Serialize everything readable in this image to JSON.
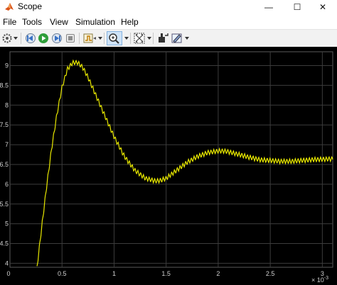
{
  "window": {
    "title": "Scope",
    "minimize_icon": "minimize-icon",
    "maximize_icon": "maximize-icon",
    "close_icon": "close-icon"
  },
  "menu": {
    "items": [
      "File",
      "Tools",
      "View",
      "Simulation",
      "Help"
    ]
  },
  "toolbar": {
    "icons": [
      "settings-gear-icon",
      "step-back-icon",
      "run-icon",
      "stop-icon",
      "trigger-icon",
      "zoom-icon",
      "autoscale-icon",
      "cursor-measure-icon",
      "style-icon"
    ]
  },
  "colors": {
    "background": "#000000",
    "grid": "#3c3c3c",
    "trace": "#e8e800",
    "tick_text": "#d0d0d0"
  },
  "chart_data": {
    "type": "line",
    "title": "",
    "xlabel": "",
    "ylabel": "",
    "x_multiplier_label": "× 10",
    "x_multiplier_exponent": "-3",
    "xlim": [
      0,
      3.1
    ],
    "ylim": [
      3.9,
      9.35
    ],
    "x_ticks": [
      "0",
      "0.5",
      "1",
      "1.5",
      "2",
      "2.5",
      "3"
    ],
    "y_ticks": [
      "4",
      "4.5",
      "5",
      "5.5",
      "6",
      "6.5",
      "7",
      "7.5",
      "8",
      "8.5",
      "9"
    ],
    "grid": true,
    "ripple_amplitude": 0.06,
    "ripple_period": 0.027,
    "series": [
      {
        "x": [
          0.26,
          0.3,
          0.35,
          0.4,
          0.45,
          0.5,
          0.55,
          0.6,
          0.65,
          0.7,
          0.75,
          0.8,
          0.9,
          1.0,
          1.1,
          1.2,
          1.3,
          1.4,
          1.45,
          1.5,
          1.6,
          1.7,
          1.8,
          1.9,
          2.0,
          2.05,
          2.1,
          2.2,
          2.3,
          2.4,
          2.5,
          2.6,
          2.7,
          2.8,
          2.9,
          3.0,
          3.1
        ],
        "y": [
          3.9,
          4.8,
          5.9,
          6.9,
          7.75,
          8.45,
          8.9,
          9.07,
          9.08,
          8.95,
          8.7,
          8.4,
          7.8,
          7.2,
          6.7,
          6.35,
          6.15,
          6.08,
          6.1,
          6.15,
          6.35,
          6.55,
          6.7,
          6.8,
          6.84,
          6.84,
          6.82,
          6.75,
          6.68,
          6.62,
          6.6,
          6.58,
          6.58,
          6.6,
          6.62,
          6.63,
          6.64
        ]
      }
    ]
  }
}
